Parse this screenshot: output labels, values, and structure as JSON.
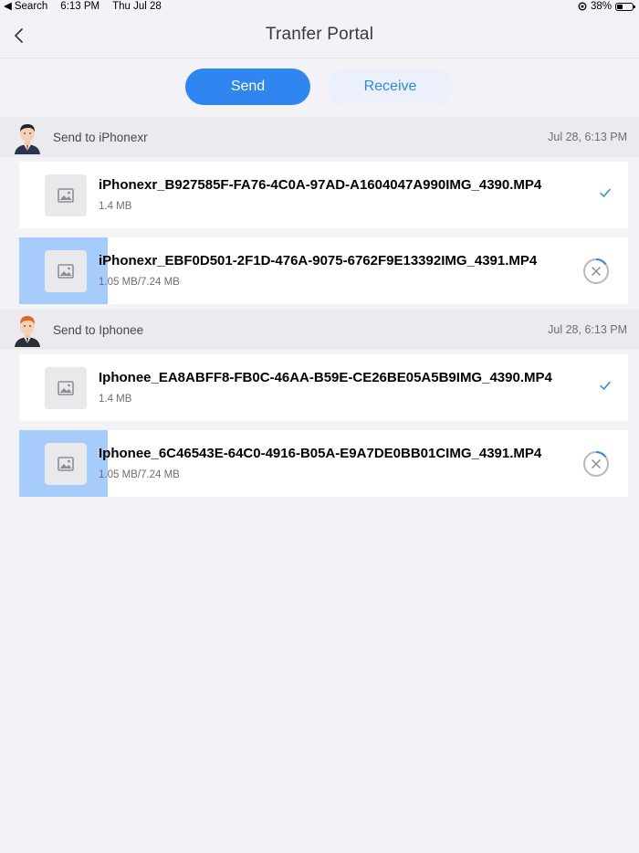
{
  "status_bar": {
    "back_label": "Search",
    "time": "6:13 PM",
    "date": "Thu Jul 28",
    "battery": "38%",
    "battery_level": 0.38
  },
  "nav": {
    "title": "Tranfer Portal"
  },
  "tabs": {
    "send": "Send",
    "receive": "Receive",
    "active": "send"
  },
  "groups": [
    {
      "label": "Send to iPhonexr",
      "time": "Jul 28, 6:13 PM",
      "avatar": "male-avatar-dark-hair",
      "files": [
        {
          "name": "iPhonexr_B927585F-FA76-4C0A-97AD-A1604047A990IMG_4390.MP4",
          "size": "1.4 MB",
          "status": "done",
          "progress": 1.0
        },
        {
          "name": "iPhonexr_EBF0D501-2F1D-476A-9075-6762F9E13392IMG_4391.MP4",
          "size": "1.05 MB/7.24 MB",
          "status": "in-progress",
          "progress": 0.145
        }
      ]
    },
    {
      "label": "Send to Iphonee",
      "time": "Jul 28, 6:13 PM",
      "avatar": "male-avatar-red-hair",
      "files": [
        {
          "name": "Iphonee_EA8ABFF8-FB0C-46AA-B59E-CE26BE05A5B9IMG_4390.MP4",
          "size": "1.4 MB",
          "status": "done",
          "progress": 1.0
        },
        {
          "name": "Iphonee_6C46543E-64C0-4916-B05A-E9A7DE0BB01CIMG_4391.MP4",
          "size": "1.05 MB/7.24 MB",
          "status": "in-progress",
          "progress": 0.145
        }
      ]
    }
  ],
  "colors": {
    "accent": "#2f86f1",
    "progress_fill": "#a5ccfb",
    "background": "#f2f2f7"
  }
}
